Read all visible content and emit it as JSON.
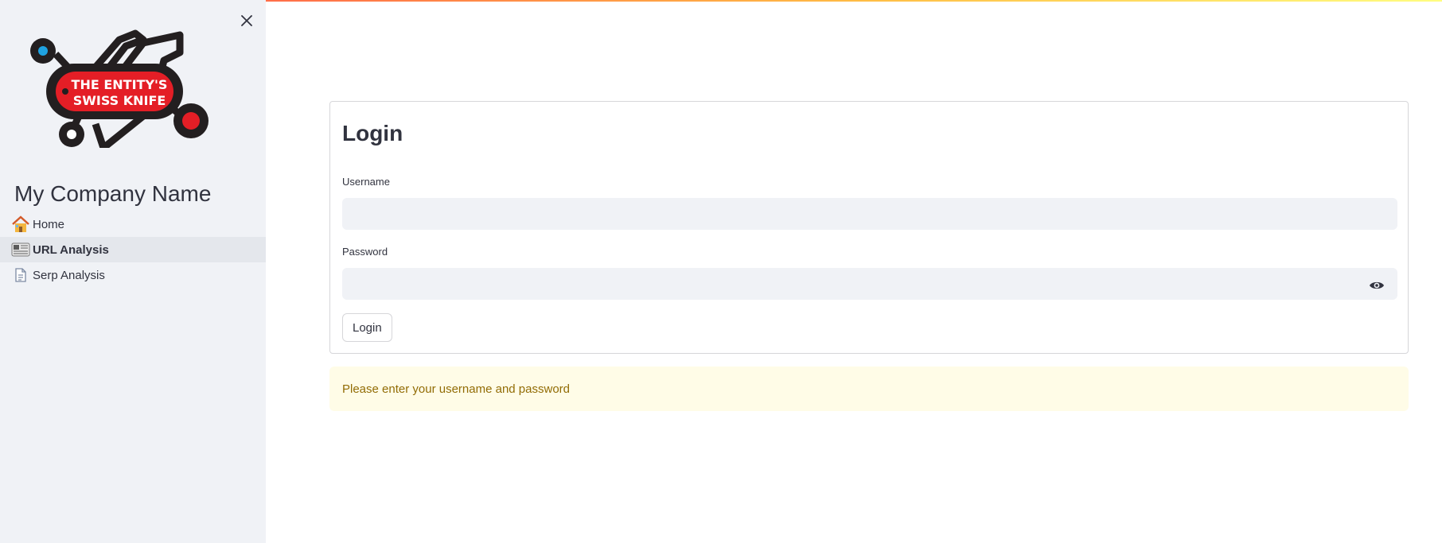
{
  "sidebar": {
    "logo_text_line1": "THE ENTITY'S",
    "logo_text_line2": "SWISS KNIFE",
    "company_name": "My Company Name",
    "close_icon": "close-icon",
    "nav": [
      {
        "label": "Home",
        "icon": "house-icon",
        "active": false
      },
      {
        "label": "URL Analysis",
        "icon": "newspaper-icon",
        "active": true
      },
      {
        "label": "Serp Analysis",
        "icon": "document-icon",
        "active": false
      }
    ]
  },
  "login": {
    "title": "Login",
    "username_label": "Username",
    "username_value": "",
    "password_label": "Password",
    "password_value": "",
    "button_label": "Login"
  },
  "warning": {
    "text": "Please enter your username and password"
  },
  "colors": {
    "sidebar_bg": "#f0f2f6",
    "active_nav_bg": "#e4e7ec",
    "warning_bg": "#fffce7",
    "warning_text": "#926c05",
    "logo_red": "#e41e26",
    "logo_blue": "#1fa2e1"
  }
}
